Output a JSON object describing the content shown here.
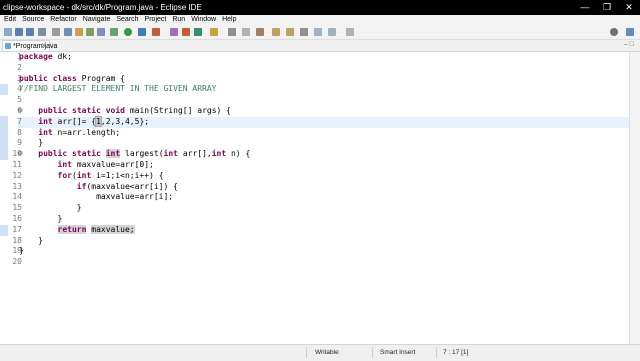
{
  "window": {
    "title": "clipse-workspace - dk/src/dk/Program.java - Eclipse IDE",
    "min_glyph": "—",
    "max_glyph": "❐",
    "close_glyph": "✕"
  },
  "menu": [
    "Edit",
    "Source",
    "Refactor",
    "Navigate",
    "Search",
    "Project",
    "Run",
    "Window",
    "Help"
  ],
  "tab": {
    "label": "*Program.java",
    "close_glyph": "✕"
  },
  "tab_controls": "– □",
  "editor": {
    "current_line": 7,
    "lines": [
      {
        "n": "1",
        "text": "package dk;"
      },
      {
        "n": "2",
        "text": ""
      },
      {
        "n": "3",
        "text": "public class Program {"
      },
      {
        "n": "4",
        "text": "//FIND LARGEST ELEMENT IN THE GIVEN ARRAY"
      },
      {
        "n": "5",
        "text": ""
      },
      {
        "n": "6",
        "text": "    public static void main(String[] args) {"
      },
      {
        "n": "7",
        "text": "    int arr[]= {1,2,3,4,5};"
      },
      {
        "n": "8",
        "text": "    int n=arr.length;"
      },
      {
        "n": "9",
        "text": "    }"
      },
      {
        "n": "10",
        "text": "    public static int largest(int arr[],int n) {"
      },
      {
        "n": "11",
        "text": "        int maxvalue=arr[0];"
      },
      {
        "n": "12",
        "text": "        for(int i=1;i<n;i++) {"
      },
      {
        "n": "13",
        "text": "            if(maxvalue<arr[i]) {"
      },
      {
        "n": "14",
        "text": "                maxvalue=arr[i];"
      },
      {
        "n": "15",
        "text": "            }"
      },
      {
        "n": "16",
        "text": "        }"
      },
      {
        "n": "17",
        "text": "        return maxvalue;"
      },
      {
        "n": "18",
        "text": "    }"
      },
      {
        "n": "19",
        "text": "}"
      },
      {
        "n": "20",
        "text": ""
      }
    ]
  },
  "status": {
    "mode": "Writable",
    "insert": "Smart Insert",
    "position": "7 : 17 [1]"
  },
  "colors": {
    "keyword": "#7f0055",
    "comment": "#3f7f5f",
    "current_line_bg": "#e8f2fe"
  }
}
